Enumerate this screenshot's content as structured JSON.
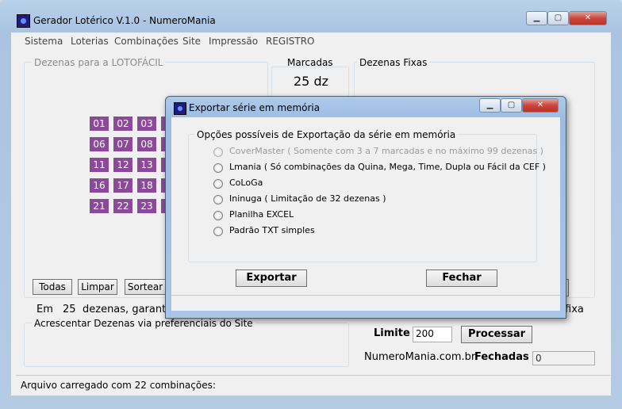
{
  "main": {
    "title": "Gerador Lotérico V.1.0 - NumeroMania",
    "menu": [
      "Sistema",
      "Loterias",
      "Combinações",
      "Site",
      "Impressão",
      "REGISTRO"
    ],
    "dezenas_group": "Dezenas para a LOTOFÁCIL",
    "marcadas_label": "Marcadas",
    "marcadas_value": "25 dz",
    "fixas_group": "Dezenas Fixas",
    "numbers": [
      "01",
      "02",
      "03",
      "06",
      "07",
      "08",
      "11",
      "12",
      "13",
      "16",
      "17",
      "18",
      "21",
      "22",
      "23"
    ],
    "buttons": {
      "todas": "Todas",
      "limpar": "Limpar",
      "sortear": "Sortear",
      "processar": "Processar"
    },
    "em_label": "Em",
    "em_value": "25",
    "dezenas_text": "dezenas, garantir",
    "fixa_text": "fixa",
    "acrescentar_group": "Acrescentar Dezenas via preferenciais do Site",
    "limite_label": "Limite",
    "limite_value": "200",
    "site_text": "NumeroMania.com.br",
    "fechadas_label": "Fechadas",
    "fechadas_value": "0",
    "status": "Arquivo carregado com 22 combinações:"
  },
  "dialog": {
    "title": "Exportar série em memória",
    "group": "Opções possíveis de Exportação da série em memória",
    "options": [
      {
        "label": "CoverMaster ( Somente com 3 a 7 marcadas e no máximo 99 dezenas )",
        "enabled": false
      },
      {
        "label": "Lmania ( Só combinações da Quina, Mega, Time, Dupla ou Fácil da CEF )",
        "enabled": true
      },
      {
        "label": "CoLoGa",
        "enabled": true
      },
      {
        "label": "Ininuga ( Limitação de 32 dezenas )",
        "enabled": true
      },
      {
        "label": "Planilha EXCEL",
        "enabled": true
      },
      {
        "label": "Padrão TXT simples",
        "enabled": true
      }
    ],
    "export_button": "Exportar",
    "close_button": "Fechar"
  },
  "icons": [
    "app-icon",
    "minimize-icon",
    "maximize-icon",
    "close-icon"
  ],
  "colors": {
    "number_bg": "#8b4a97",
    "close_button": "#c9463d",
    "title_bar": "#b9d1ea"
  }
}
